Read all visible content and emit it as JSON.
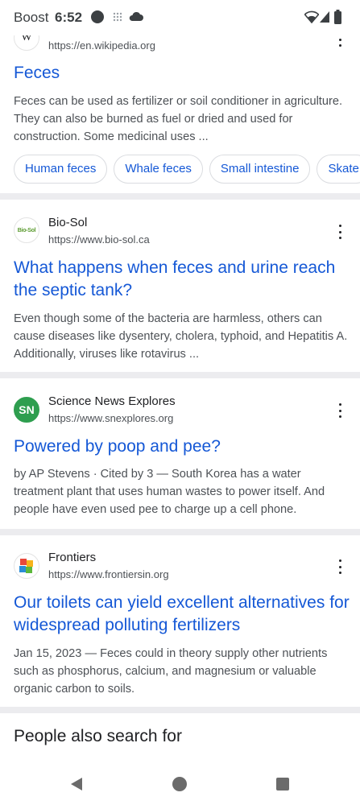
{
  "status_bar": {
    "carrier": "Boost",
    "time": "6:52"
  },
  "results": [
    {
      "favicon_letter": "W",
      "url": "https://en.wikipedia.org",
      "title": "Feces",
      "snippet": "Feces can be used as fertilizer or soil conditioner in agriculture. They can also be burned as fuel or dried and used for construction. Some medicinal uses ...",
      "chips": [
        "Human feces",
        "Whale feces",
        "Small intestine",
        "Skate"
      ]
    },
    {
      "site_name": "Bio-Sol",
      "favicon_text": "Bio-Sol",
      "url": "https://www.bio-sol.ca",
      "title": "What happens when feces and urine reach the septic tank?",
      "snippet": "Even though some of the bacteria are harmless, others can cause diseases like dysentery, cholera, typhoid, and Hepatitis A. Additionally, viruses like rotavirus ..."
    },
    {
      "site_name": "Science News Explores",
      "favicon_text": "SN",
      "url": "https://www.snexplores.org",
      "title": "Powered by poop and pee?",
      "snippet": "by AP Stevens · Cited by 3 — South Korea has a water treatment plant that uses human wastes to power itself. And people have even used pee to charge up a cell phone."
    },
    {
      "site_name": "Frontiers",
      "url": "https://www.frontiersin.org",
      "title": "Our toilets can yield excellent alternatives for widespread polluting fertilizers",
      "snippet": "Jan 15, 2023 — Feces could in theory supply other nutrients such as phosphorus, calcium, and magnesium or valuable organic carbon to soils."
    }
  ],
  "people_also_search": {
    "heading": "People also search for"
  },
  "colors": {
    "link": "#1558d6",
    "snippet": "#4d5156",
    "divider": "#ececef",
    "sn_green": "#2e9e4f"
  },
  "icons": {
    "status": [
      "notification-dot-icon",
      "app-grid-icon",
      "cloud-icon",
      "wifi-icon",
      "signal-icon",
      "battery-icon"
    ],
    "nav": [
      "back-icon",
      "home-icon",
      "recents-icon"
    ],
    "result_menu": "more-vert-icon"
  }
}
